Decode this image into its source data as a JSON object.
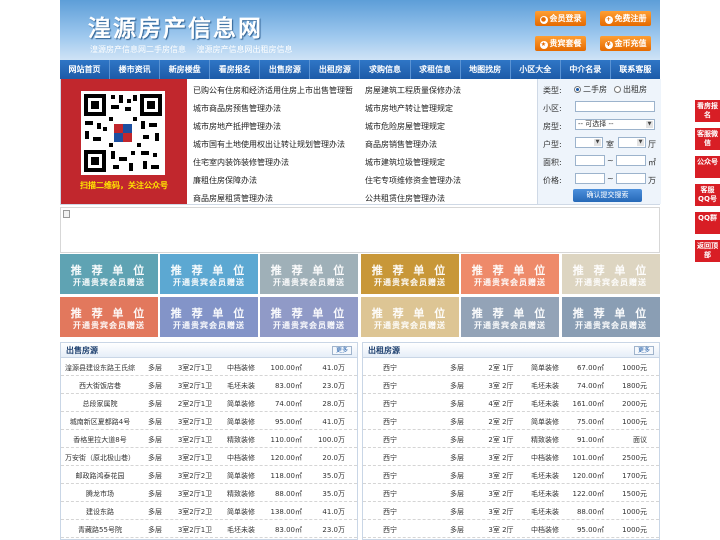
{
  "header": {
    "title": "湟源房产信息网",
    "sublinks": [
      "湟源房产信息网二手房信息",
      "湟源房产信息网出租房信息"
    ],
    "buttons": [
      {
        "label": "会员登录",
        "icon": "user-icon"
      },
      {
        "label": "免费注册",
        "icon": "register-icon"
      },
      {
        "label": "贵宾套餐",
        "icon": "vip-icon"
      },
      {
        "label": "金币充值",
        "icon": "coin-icon"
      }
    ]
  },
  "nav": [
    "网站首页",
    "楼市资讯",
    "新房楼盘",
    "看房报名",
    "出售房源",
    "出租房源",
    "求购信息",
    "求租信息",
    "地图找房",
    "小区大全",
    "中介名录",
    "联系客服"
  ],
  "qr": {
    "caption": "扫描二维码，关注公众号"
  },
  "policies": {
    "left": [
      "已购公有住房和经济适用住房上市出售管理暂",
      "城市商品房预售管理办法",
      "城市房地产抵押管理办法",
      "城市国有土地使用权出让转让规划管理办法",
      "住宅室内装饰装修管理办法",
      "廉租住房保障办法",
      "商品房屋租赁管理办法"
    ],
    "right": [
      "房屋建筑工程质量保修办法",
      "城市房地产转让管理规定",
      "城市危险房屋管理规定",
      "商品房销售管理办法",
      "城市建筑垃圾管理规定",
      "住宅专项维修资金管理办法",
      "公共租赁住房管理办法"
    ]
  },
  "search": {
    "type_label": "类型:",
    "radio_options": [
      "二手房",
      "出租房"
    ],
    "community_label": "小区:",
    "house_type_label": "房型:",
    "house_type_value": "-- 可选择 --",
    "layout_label": "户型:",
    "room_unit": "室",
    "hall_unit": "厅",
    "area_label": "面积:",
    "area_unit": "㎡",
    "price_label": "价格:",
    "price_unit": "万",
    "range_sep": "~",
    "submit_label": "确认提交搜索"
  },
  "ads": {
    "line1": "推 荐 单 位",
    "line2": "开通贵宾会员赠送",
    "colors": [
      "#5fa3b3",
      "#5ca8d2",
      "#9fb0b8",
      "#c89738",
      "#ee8a6a",
      "#ddd5c1",
      "#e2785d",
      "#8394c8",
      "#909ac7",
      "#ddc594",
      "#93a3b7",
      "#8a9eb4"
    ]
  },
  "sale": {
    "title": "出售房源",
    "more": "更多",
    "rows": [
      [
        "湟源县建设东路王氏综",
        "多层",
        "3室2厅1卫",
        "中档装修",
        "100.00㎡",
        "41.0万"
      ],
      [
        "西大街饭店巷",
        "多层",
        "3室2厅1卫",
        "毛坯未装",
        "83.00㎡",
        "23.0万"
      ],
      [
        "总段家属院",
        "多层",
        "2室2厅1卫",
        "简单装修",
        "74.00㎡",
        "28.0万"
      ],
      [
        "城南新区夏都路4号",
        "多层",
        "3室2厅1卫",
        "简单装修",
        "95.00㎡",
        "41.0万"
      ],
      [
        "香格里拉大道8号",
        "多层",
        "3室2厅1卫",
        "精致装修",
        "110.00㎡",
        "100.0万"
      ],
      [
        "万安街（原北极山巷）",
        "多层",
        "3室2厅1卫",
        "中档装修",
        "120.00㎡",
        "20.0万"
      ],
      [
        "邮政路鸿泰花园",
        "多层",
        "3室2厅2卫",
        "简单装修",
        "118.00㎡",
        "35.0万"
      ],
      [
        "腾龙市场",
        "多层",
        "3室2厅1卫",
        "精致装修",
        "88.00㎡",
        "35.0万"
      ],
      [
        "建设东路",
        "多层",
        "3室2厅2卫",
        "简单装修",
        "138.00㎡",
        "41.0万"
      ],
      [
        "青藏路55号院",
        "多层",
        "3室2厅1卫",
        "毛坯未装",
        "83.00㎡",
        "23.0万"
      ]
    ]
  },
  "rent": {
    "title": "出租房源",
    "more": "更多",
    "rows": [
      [
        "西宁",
        "多层",
        "2室 1厅",
        "简单装修",
        "67.00㎡",
        "1000元"
      ],
      [
        "西宁",
        "多层",
        "3室 2厅",
        "毛坯未装",
        "74.00㎡",
        "1800元"
      ],
      [
        "西宁",
        "多层",
        "4室 2厅",
        "毛坯未装",
        "161.00㎡",
        "2000元"
      ],
      [
        "西宁",
        "多层",
        "2室 2厅",
        "简单装修",
        "75.00㎡",
        "1000元"
      ],
      [
        "西宁",
        "多层",
        "2室 1厅",
        "精致装修",
        "91.00㎡",
        "面议"
      ],
      [
        "西宁",
        "多层",
        "3室 2厅",
        "中档装修",
        "101.00㎡",
        "2500元"
      ],
      [
        "西宁",
        "多层",
        "3室 2厅",
        "毛坯未装",
        "120.00㎡",
        "1700元"
      ],
      [
        "西宁",
        "多层",
        "3室 2厅",
        "毛坯未装",
        "122.00㎡",
        "1500元"
      ],
      [
        "西宁",
        "多层",
        "3室 2厅",
        "毛坯未装",
        "88.00㎡",
        "1000元"
      ],
      [
        "西宁",
        "多层",
        "3室 2厅",
        "中档装修",
        "95.00㎡",
        "1000元"
      ]
    ]
  },
  "float_bar": [
    "看房报名",
    "客服微信",
    "公众号",
    "客服QQ号",
    "QQ群",
    "返回顶部"
  ]
}
